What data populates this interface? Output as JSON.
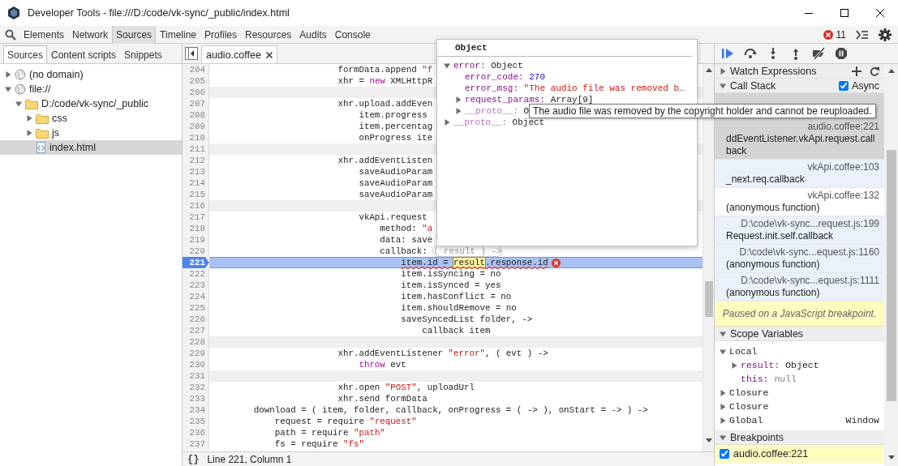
{
  "window": {
    "title": "Developer Tools - file:///D:/code/vk-sync/_public/index.html"
  },
  "panel_tabs": [
    {
      "label": "Elements",
      "selected": false
    },
    {
      "label": "Network",
      "selected": false
    },
    {
      "label": "Sources",
      "selected": true
    },
    {
      "label": "Timeline",
      "selected": false
    },
    {
      "label": "Profiles",
      "selected": false
    },
    {
      "label": "Resources",
      "selected": false
    },
    {
      "label": "Audits",
      "selected": false
    },
    {
      "label": "Console",
      "selected": false
    }
  ],
  "error_count": "11",
  "navigator": {
    "tabs": [
      {
        "label": "Sources",
        "selected": true
      },
      {
        "label": "Content scripts",
        "selected": false
      },
      {
        "label": "Snippets",
        "selected": false
      }
    ],
    "tree": [
      {
        "label": "(no domain)",
        "kind": "domain",
        "expanded": false,
        "selected": false
      },
      {
        "label": "file://",
        "kind": "domain",
        "expanded": true,
        "selected": false,
        "children": [
          {
            "label": "D:/code/vk-sync/_public",
            "kind": "folder",
            "expanded": true,
            "selected": false,
            "children": [
              {
                "label": "css",
                "kind": "folder",
                "expanded": false,
                "selected": false
              },
              {
                "label": "js",
                "kind": "folder",
                "expanded": false,
                "selected": false
              },
              {
                "label": "index.html",
                "kind": "file",
                "selected": true
              }
            ]
          }
        ]
      }
    ]
  },
  "editor": {
    "tabs": [
      {
        "label": "audio.coffee",
        "selected": true
      }
    ],
    "lines": [
      {
        "number": "204",
        "kind": "code",
        "tokens": [
          {
            "text": "                        formData.append ",
            "kind": "plain"
          },
          {
            "text": "\"f",
            "kind": "string"
          }
        ]
      },
      {
        "number": "205",
        "kind": "code",
        "tokens": [
          {
            "text": "                        xhr = ",
            "kind": "plain"
          },
          {
            "text": "new",
            "kind": "keyword"
          },
          {
            "text": " XMLHttpR",
            "kind": "plain"
          }
        ]
      },
      {
        "number": "206",
        "kind": "blank"
      },
      {
        "number": "207",
        "kind": "code",
        "tokens": [
          {
            "text": "                        xhr.upload.addEven",
            "kind": "plain"
          }
        ]
      },
      {
        "number": "208",
        "kind": "code",
        "tokens": [
          {
            "text": "                            item.progress",
            "kind": "plain"
          }
        ]
      },
      {
        "number": "209",
        "kind": "code",
        "tokens": [
          {
            "text": "                            item.percentag",
            "kind": "plain"
          }
        ]
      },
      {
        "number": "210",
        "kind": "code",
        "tokens": [
          {
            "text": "                            onProgress ite",
            "kind": "plain"
          }
        ]
      },
      {
        "number": "211",
        "kind": "blank"
      },
      {
        "number": "212",
        "kind": "code",
        "tokens": [
          {
            "text": "                        xhr.addEventListen",
            "kind": "plain"
          }
        ]
      },
      {
        "number": "213",
        "kind": "code",
        "tokens": [
          {
            "text": "                            saveAudioParam",
            "kind": "plain"
          }
        ]
      },
      {
        "number": "214",
        "kind": "code",
        "tokens": [
          {
            "text": "                            saveAudioParam",
            "kind": "plain"
          }
        ]
      },
      {
        "number": "215",
        "kind": "code",
        "tokens": [
          {
            "text": "                            saveAudioParam",
            "kind": "plain"
          }
        ]
      },
      {
        "number": "216",
        "kind": "blank"
      },
      {
        "number": "217",
        "kind": "code",
        "tokens": [
          {
            "text": "                            vkApi.request",
            "kind": "plain"
          }
        ]
      },
      {
        "number": "218",
        "kind": "code",
        "tokens": [
          {
            "text": "                                method: ",
            "kind": "plain"
          },
          {
            "text": "\"a",
            "kind": "string"
          }
        ]
      },
      {
        "number": "219",
        "kind": "code",
        "tokens": [
          {
            "text": "                                data: save",
            "kind": "plain"
          }
        ]
      },
      {
        "number": "220",
        "kind": "code",
        "tokens": [
          {
            "text": "                                callback: ",
            "kind": "plain"
          },
          {
            "text": "( result ) ->",
            "kind": "hovered"
          }
        ]
      },
      {
        "number": "221",
        "kind": "paused",
        "tokens": [
          {
            "text": "                                    item.id = ",
            "kind": "plain"
          },
          {
            "text": "result",
            "kind": "highlight"
          },
          {
            "text": ".response.id",
            "kind": "plain"
          }
        ]
      },
      {
        "number": "222",
        "kind": "code",
        "tokens": [
          {
            "text": "                                    item.isSyncing = no",
            "kind": "plain"
          }
        ]
      },
      {
        "number": "223",
        "kind": "code",
        "tokens": [
          {
            "text": "                                    item.isSynced = yes",
            "kind": "plain"
          }
        ]
      },
      {
        "number": "224",
        "kind": "code",
        "tokens": [
          {
            "text": "                                    item.hasConflict = no",
            "kind": "plain"
          }
        ]
      },
      {
        "number": "225",
        "kind": "code",
        "tokens": [
          {
            "text": "                                    item.shouldRemove = no",
            "kind": "plain"
          }
        ]
      },
      {
        "number": "226",
        "kind": "code",
        "tokens": [
          {
            "text": "                                    saveSyncedList folder, ->",
            "kind": "plain"
          }
        ]
      },
      {
        "number": "227",
        "kind": "code",
        "tokens": [
          {
            "text": "                                        callback item",
            "kind": "plain"
          }
        ]
      },
      {
        "number": "228",
        "kind": "blank"
      },
      {
        "number": "229",
        "kind": "code",
        "tokens": [
          {
            "text": "                        xhr.addEventListener ",
            "kind": "plain"
          },
          {
            "text": "\"error\"",
            "kind": "string"
          },
          {
            "text": ", ( evt ) ->",
            "kind": "plain"
          }
        ]
      },
      {
        "number": "230",
        "kind": "code",
        "tokens": [
          {
            "text": "                            throw",
            "kind": "keyword"
          },
          {
            "text": " evt",
            "kind": "plain"
          }
        ]
      },
      {
        "number": "231",
        "kind": "blank"
      },
      {
        "number": "232",
        "kind": "code",
        "tokens": [
          {
            "text": "                        xhr.open ",
            "kind": "plain"
          },
          {
            "text": "\"POST\"",
            "kind": "string"
          },
          {
            "text": ", uploadUrl",
            "kind": "plain"
          }
        ]
      },
      {
        "number": "233",
        "kind": "code",
        "tokens": [
          {
            "text": "                        xhr.send formData",
            "kind": "plain"
          }
        ]
      },
      {
        "number": "234",
        "kind": "code",
        "tokens": [
          {
            "text": "        download = ( item, folder, callback, onProgress = ( -> ), onStart = -> ) ->",
            "kind": "plain"
          }
        ]
      },
      {
        "number": "235",
        "kind": "code",
        "tokens": [
          {
            "text": "            request = require ",
            "kind": "plain"
          },
          {
            "text": "\"request\"",
            "kind": "string"
          }
        ]
      },
      {
        "number": "236",
        "kind": "code",
        "tokens": [
          {
            "text": "            path = require ",
            "kind": "plain"
          },
          {
            "text": "\"path\"",
            "kind": "string"
          }
        ]
      },
      {
        "number": "237",
        "kind": "code",
        "tokens": [
          {
            "text": "            fs = require ",
            "kind": "plain"
          },
          {
            "text": "\"fs\"",
            "kind": "string"
          }
        ]
      }
    ],
    "format_button": "{}",
    "status": "Line 221, Column 1"
  },
  "object_popup": {
    "title": "Object",
    "tree": [
      {
        "key": "error:",
        "value": "Object",
        "kind": "object",
        "internal": false,
        "expanded": true,
        "children": [
          {
            "key": "error_code:",
            "value": "270",
            "kind": "number",
            "internal": false
          },
          {
            "key": "error_msg:",
            "value": "\"The audio file was removed b…",
            "kind": "string",
            "internal": false
          },
          {
            "key": "request_params:",
            "value": "Array[9]",
            "kind": "object",
            "internal": false,
            "expanded": false
          },
          {
            "key": "__proto__:",
            "value": "O",
            "kind": "object",
            "internal": true,
            "expanded": false
          }
        ]
      },
      {
        "key": "__proto__:",
        "value": "Object",
        "kind": "object",
        "internal": true,
        "expanded": false
      }
    ]
  },
  "tooltip": {
    "text": "The audio file was removed by the copyright holder and cannot be reuploaded."
  },
  "sidebar": {
    "watch": {
      "title": "Watch Expressions",
      "expanded": false
    },
    "call_stack": {
      "title": "Call Stack",
      "expanded": true,
      "async_label": "Async",
      "async_checked": true,
      "frames": [
        {
          "location": "audio.coffee:221",
          "function": "ddEventListener.vkApi.request.callback",
          "selected": true
        },
        {
          "location": "vkApi.coffee:103",
          "function": "_next.req.callback",
          "selected": false,
          "tinted": true
        },
        {
          "location": "vkApi.coffee:132",
          "function": "(anonymous function)",
          "selected": false,
          "tinted": false
        },
        {
          "location": "D:\\code\\vk-sync...request.js:199",
          "function": "Request.init.self.callback",
          "selected": false,
          "tinted": true
        },
        {
          "location": "D:\\code\\vk-sync...equest.js:1160",
          "function": "(anonymous function)",
          "selected": false,
          "tinted": true
        },
        {
          "location": "D:\\code\\vk-sync...equest.js:1111",
          "function": "(anonymous function)",
          "selected": false,
          "tinted": true
        }
      ]
    },
    "paused_message": "Paused on a JavaScript breakpoint.",
    "scope": {
      "title": "Scope Variables",
      "expanded": true,
      "groups": [
        {
          "name": "Local",
          "expanded": true,
          "vars": [
            {
              "key": "result:",
              "value": "Object",
              "kind": "object",
              "expanded": false
            },
            {
              "key": "this:",
              "value": "null",
              "kind": "null"
            }
          ]
        },
        {
          "name": "Closure",
          "expanded": false
        },
        {
          "name": "Closure",
          "expanded": false
        },
        {
          "name": "Global",
          "expanded": false,
          "value": "Window"
        }
      ]
    },
    "breakpoints": {
      "title": "Breakpoints",
      "expanded": true,
      "items": [
        {
          "label": "audio.coffee:221",
          "checked": true
        }
      ]
    }
  }
}
